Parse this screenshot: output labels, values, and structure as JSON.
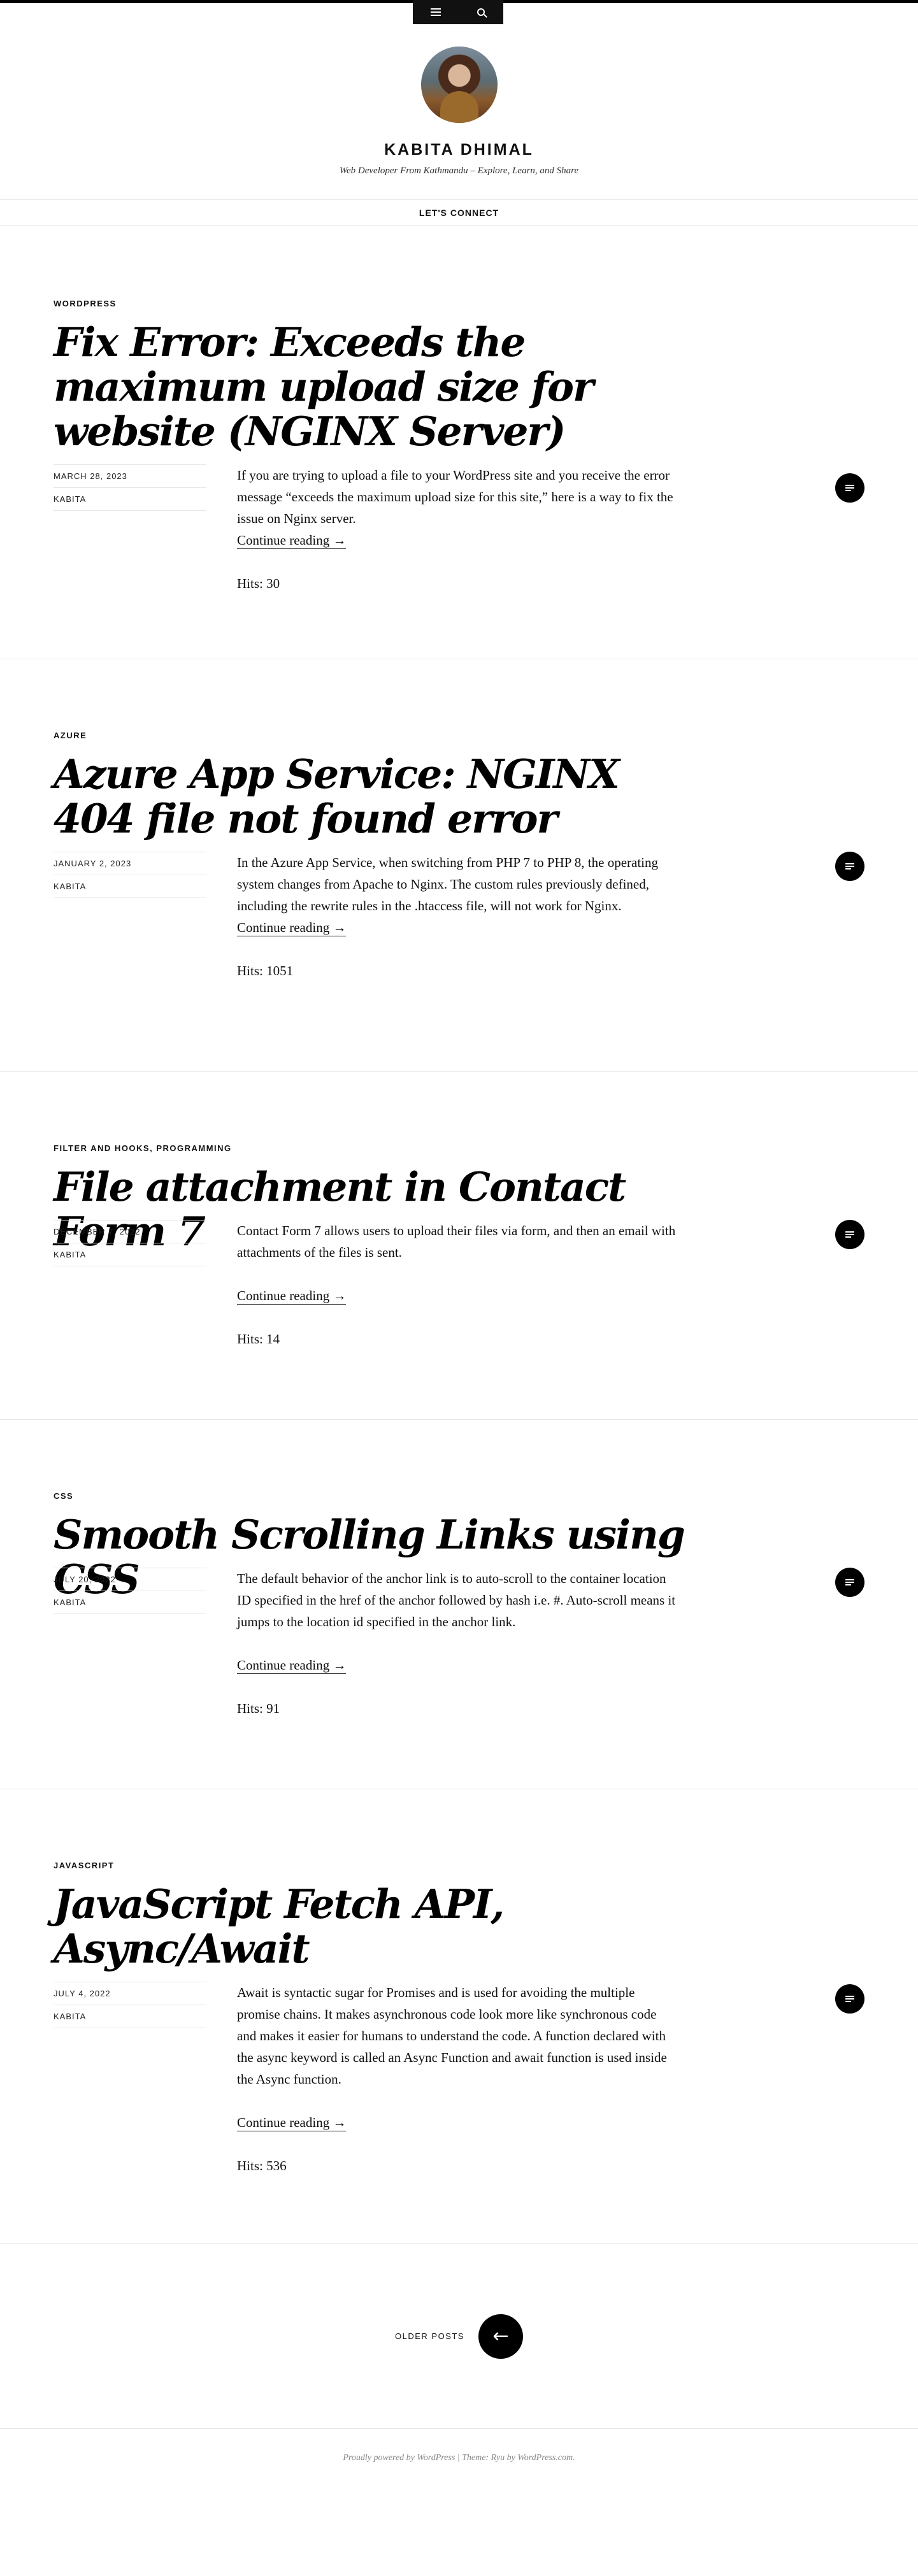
{
  "nav": {
    "menu_icon": "menu-icon",
    "search_icon": "search-icon"
  },
  "site": {
    "title": "KABITA DHIMAL",
    "description": "Web Developer From Kathmandu – Explore, Learn, and Share"
  },
  "connect": {
    "label": "LET'S CONNECT"
  },
  "posts": [
    {
      "category": "WORDPRESS",
      "title": "Fix Error: Exceeds the maximum upload size for website (NGINX Server)",
      "date": "MARCH 28, 2023",
      "author": "KABITA",
      "excerpt": "If you are trying to upload a file to your WordPress site and you receive the error message “exceeds the maximum upload size for this site,” here is a way to fix the issue on Nginx server.",
      "more": "Continue reading →",
      "hits": "Hits: 30"
    },
    {
      "category": "AZURE",
      "title": "Azure App Service: NGINX 404 file not found error",
      "date": "JANUARY 2, 2023",
      "author": "KABITA",
      "excerpt": "In the Azure App Service, when switching from PHP 7 to PHP 8, the operating system changes from Apache to Nginx. The custom rules previously defined, including the rewrite rules in the .htaccess file, will not work for Nginx.",
      "more": "Continue reading →",
      "hits": "Hits: 1051"
    },
    {
      "category": "FILTER AND HOOKS, PROGRAMMING",
      "title": "File attachment in Contact Form 7",
      "date": "DECEMBER 7, 2022",
      "author": "KABITA",
      "excerpt": "Contact Form 7 allows users to upload their files via form, and then an email with attachments of the files is sent.",
      "more": "Continue reading →",
      "hits": "Hits: 14"
    },
    {
      "category": "CSS",
      "title": "Smooth Scrolling Links using CSS",
      "date": "JULY 20, 2022",
      "author": "KABITA",
      "excerpt": "The default behavior of the anchor link is to auto-scroll to the container location ID specified in the href of the anchor followed by hash i.e. #. Auto-scroll means it jumps to the location id specified in the anchor link.",
      "more": "Continue reading →",
      "hits": "Hits: 91"
    },
    {
      "category": "JAVASCRIPT",
      "title": "JavaScript Fetch API, Async/Await",
      "date": "JULY 4, 2022",
      "author": "KABITA",
      "excerpt": "Await is syntactic sugar for Promises and is used for avoiding the multiple promise chains. It makes asynchronous code look more like synchronous code and makes it easier for humans to understand the code. A function declared with the async keyword is called an Async Function and await function is used inside the Async function.",
      "more": "Continue reading →",
      "hits": "Hits: 536"
    }
  ],
  "pager": {
    "older_label": "OLDER POSTS",
    "arrow": "←"
  },
  "footer": {
    "credit": "Proudly powered by WordPress | Theme: Ryu by WordPress.com."
  }
}
